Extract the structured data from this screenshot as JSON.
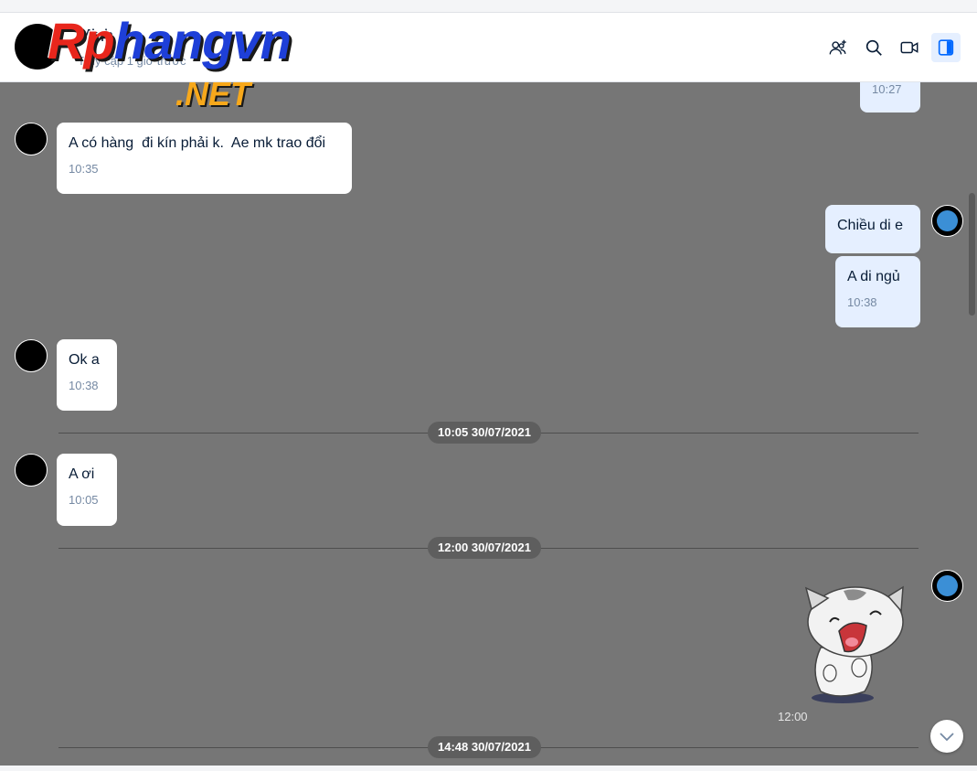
{
  "header": {
    "name": "Minh",
    "subtitle": "Truy cập 1 giờ trước"
  },
  "watermark": {
    "main_red": "Rp",
    "main_blue": "hangvn",
    "net": ".NET"
  },
  "icons": {
    "add_member": "add-member-icon",
    "search": "search-icon",
    "video": "video-call-icon",
    "sidebar": "sidebar-toggle-icon",
    "scroll_down": "chevron-down-icon"
  },
  "colors": {
    "chat_background": "#767676",
    "my_bubble": "#e5efff",
    "their_bubble": "#ffffff",
    "accent": "#0068ff"
  },
  "messages": {
    "m0": {
      "time": "10:27"
    },
    "m1": {
      "text": "A có hàng  đi kín phải k.  Ae mk trao đổi",
      "time": "10:35"
    },
    "m2": {
      "text": "Chiều di e"
    },
    "m3": {
      "text": "A di ngủ",
      "time": "10:38"
    },
    "m4": {
      "text": "Ok a",
      "time": "10:38"
    },
    "m5": {
      "text": "A ơi",
      "time": "10:05"
    },
    "sticker": {
      "time": "12:00"
    }
  },
  "dividers": {
    "d1": "10:05 30/07/2021",
    "d2": "12:00 30/07/2021",
    "d3": "14:48 30/07/2021"
  }
}
